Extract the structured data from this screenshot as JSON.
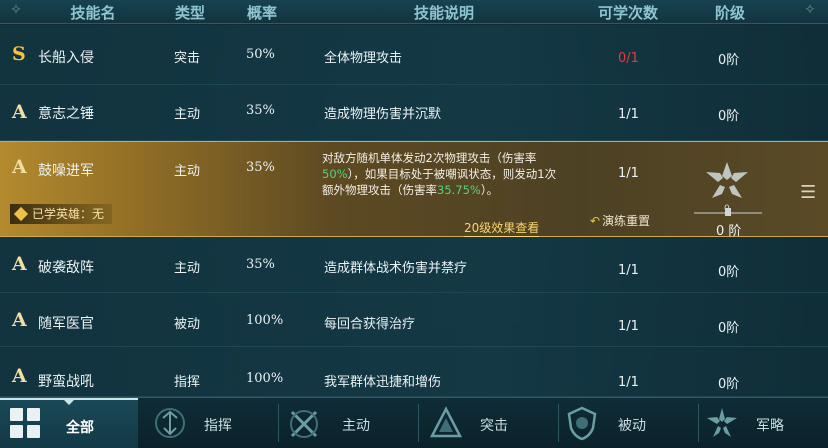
{
  "header": {
    "col_name": "技能名",
    "col_type": "类型",
    "col_rate": "概率",
    "col_desc": "技能说明",
    "col_count": "可学次数",
    "col_level": "阶级"
  },
  "rows": [
    {
      "grade": "S",
      "name": "长船入侵",
      "type": "突击",
      "rate": "50%",
      "desc": "全体物理攻击",
      "count": "0/1",
      "level": "0阶"
    },
    {
      "grade": "A",
      "name": "意志之锤",
      "type": "主动",
      "rate": "35%",
      "desc": "造成物理伤害并沉默",
      "count": "1/1",
      "level": "0阶"
    },
    {
      "grade": "A",
      "name": "破袭敌阵",
      "type": "主动",
      "rate": "35%",
      "desc": "造成群体战术伤害并禁疗",
      "count": "1/1",
      "level": "0阶"
    },
    {
      "grade": "A",
      "name": "随军医官",
      "type": "被动",
      "rate": "100%",
      "desc": "每回合获得治疗",
      "count": "1/1",
      "level": "0阶"
    },
    {
      "grade": "A",
      "name": "野蛮战吼",
      "type": "指挥",
      "rate": "100%",
      "desc": "我军群体迅捷和增伤",
      "count": "1/1",
      "level": "0阶"
    }
  ],
  "selected": {
    "grade": "A",
    "name": "鼓噪进军",
    "type": "主动",
    "rate": "35%",
    "desc_part1": "对敌方随机单体发动2次物理攻击（伤害率",
    "desc_hl1": "50%",
    "desc_part2": "），如果目标处于被嘲讽状态，则发动1次额外物理攻击（伤害率",
    "desc_hl2": "35.75%",
    "desc_part3": "）。",
    "view_effect": "20级效果查看",
    "learned_tag": "已学英雄：无",
    "count": "1/1",
    "reset": "演练重置",
    "star_value": "0",
    "level": "0 阶"
  },
  "tabs": [
    {
      "label": "全部",
      "icon": "grid-icon",
      "active": true
    },
    {
      "label": "指挥",
      "icon": "command-icon",
      "active": false
    },
    {
      "label": "主动",
      "icon": "active-swords-icon",
      "active": false
    },
    {
      "label": "突击",
      "icon": "assault-icon",
      "active": false
    },
    {
      "label": "被动",
      "icon": "passive-shield-icon",
      "active": false
    },
    {
      "label": "军略",
      "icon": "strategy-star-icon",
      "active": false
    }
  ],
  "colors": {
    "highlight": "#59d17a",
    "count_unavailable": "#e23a3a",
    "selected_row": "#b48a2e",
    "link": "#f6d56b"
  }
}
